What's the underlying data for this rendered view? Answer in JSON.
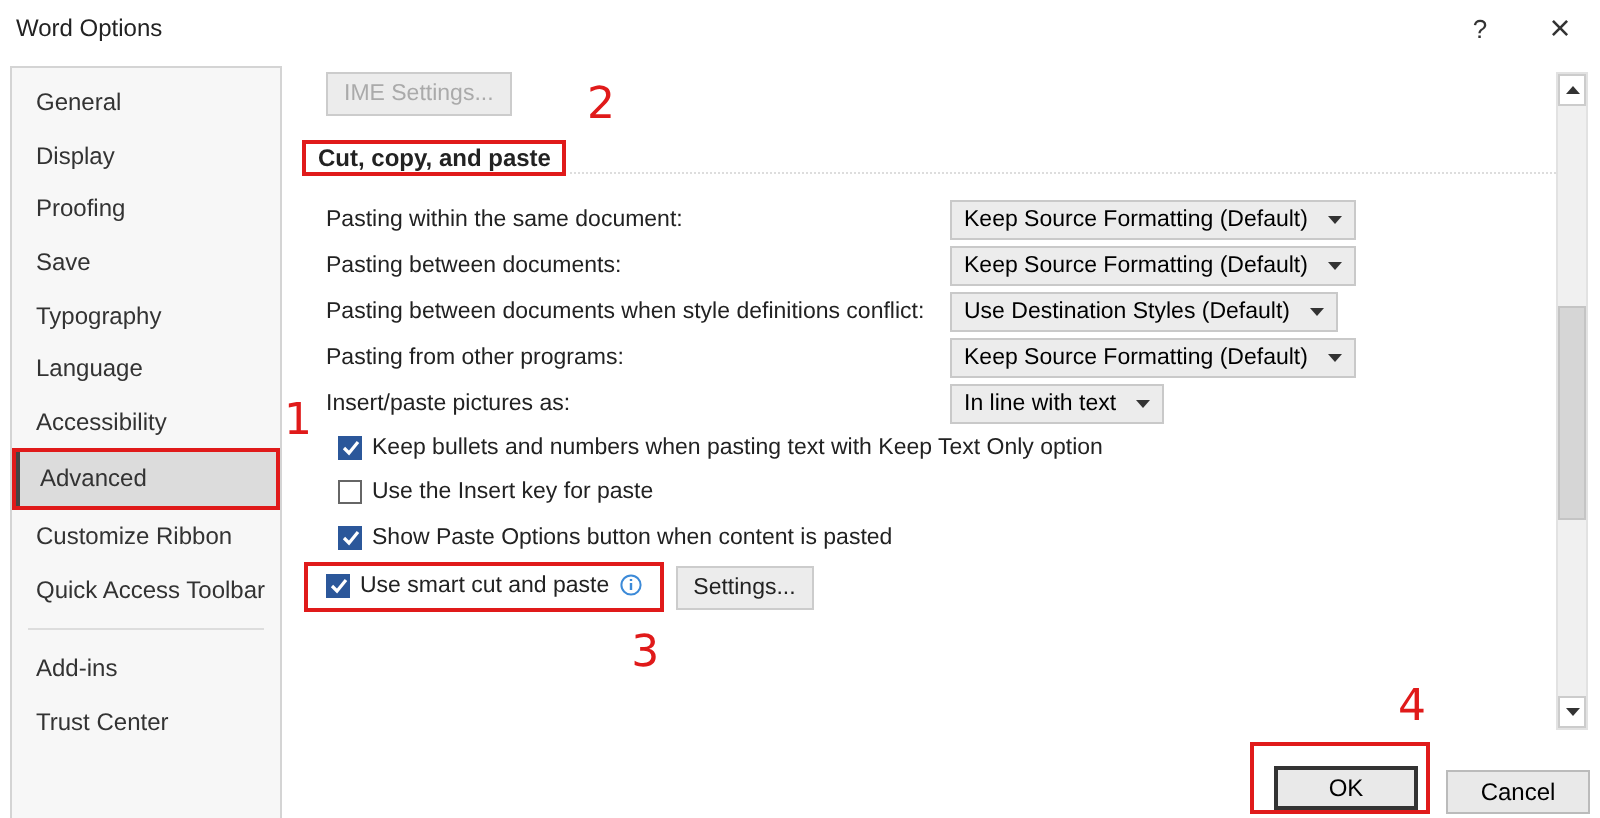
{
  "window": {
    "title": "Word Options",
    "help": "?",
    "close": "×"
  },
  "sidebar": {
    "groups": [
      [
        {
          "label": "General",
          "selected": false
        },
        {
          "label": "Display",
          "selected": false
        },
        {
          "label": "Proofing",
          "selected": false
        },
        {
          "label": "Save",
          "selected": false
        },
        {
          "label": "Typography",
          "selected": false
        },
        {
          "label": "Language",
          "selected": false
        },
        {
          "label": "Accessibility",
          "selected": false
        },
        {
          "label": "Advanced",
          "selected": true,
          "highlighted": true,
          "callout": "1"
        },
        {
          "label": "Customize Ribbon",
          "selected": false
        },
        {
          "label": "Quick Access Toolbar",
          "selected": false
        }
      ],
      [
        {
          "label": "Add-ins",
          "selected": false
        },
        {
          "label": "Trust Center",
          "selected": false
        }
      ]
    ]
  },
  "ime_button": {
    "label": "IME Settings...",
    "disabled": true
  },
  "section": {
    "heading": "Cut, copy, and paste",
    "highlighted": true,
    "callout": "2"
  },
  "settings": [
    {
      "kind": "dropdown",
      "label": "Pasting within the same document:",
      "value": "Keep Source Formatting (Default)"
    },
    {
      "kind": "dropdown",
      "label": "Pasting between documents:",
      "value": "Keep Source Formatting (Default)"
    },
    {
      "kind": "dropdown",
      "label": "Pasting between documents when style definitions conflict:",
      "value": "Use Destination Styles (Default)"
    },
    {
      "kind": "dropdown",
      "label": "Pasting from other programs:",
      "value": "Keep Source Formatting (Default)"
    },
    {
      "kind": "dropdown",
      "label": "Insert/paste pictures as:",
      "value": "In line with text"
    },
    {
      "kind": "checkbox",
      "label": "Keep bullets and numbers when pasting text with Keep Text Only option",
      "checked": true
    },
    {
      "kind": "checkbox",
      "label": "Use the Insert key for paste",
      "checked": false
    },
    {
      "kind": "checkbox",
      "label": "Show Paste Options button when content is pasted",
      "checked": true
    },
    {
      "kind": "checkbox",
      "label": "Use smart cut and paste",
      "checked": true,
      "info": true,
      "button": "Settings...",
      "highlighted": true,
      "callout": "3"
    }
  ],
  "footer": [
    {
      "label": "OK",
      "default": true,
      "highlighted": true,
      "callout": "4"
    },
    {
      "label": "Cancel",
      "default": false
    }
  ]
}
